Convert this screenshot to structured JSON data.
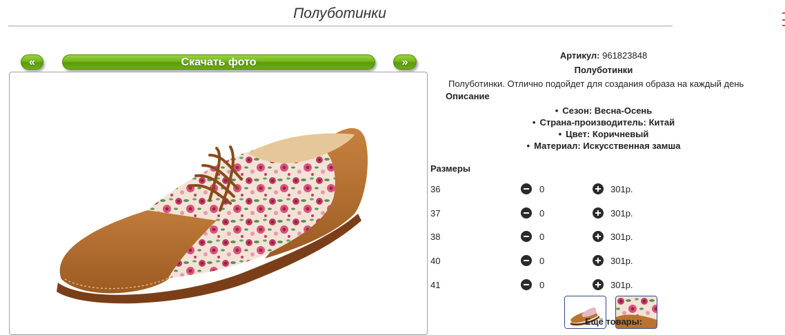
{
  "page": {
    "title": "Полуботинки"
  },
  "gallery": {
    "prev_label": "«",
    "download_label": "Скачать фото",
    "next_label": "»",
    "button_color": "#76b51b"
  },
  "product": {
    "article_label": "Артикул:",
    "article_value": "961823848",
    "name": "Полуботинки",
    "description": "Полуботинки. Отлично подойдет для создания образа на каждый день",
    "description_heading": "Описание",
    "properties": [
      "Сезон: Весна-Осень",
      "Страна-производитель: Китай",
      "Цвет: Коричневый",
      "Материал: Искусственная замша"
    ]
  },
  "sizes": {
    "heading": "Размеры",
    "rows": [
      {
        "size": "36",
        "qty": "0",
        "price": "301р."
      },
      {
        "size": "37",
        "qty": "0",
        "price": "301р."
      },
      {
        "size": "38",
        "qty": "0",
        "price": "301р."
      },
      {
        "size": "40",
        "qty": "0",
        "price": "301р."
      },
      {
        "size": "41",
        "qty": "0",
        "price": "301р."
      }
    ],
    "minus_icon": "minus-circle-icon",
    "plus_icon": "plus-circle-icon"
  },
  "thumbnails": [
    "shoe-thumbnail",
    "floral-fabric-thumbnail"
  ],
  "more_products_label": "Ещё товары:"
}
